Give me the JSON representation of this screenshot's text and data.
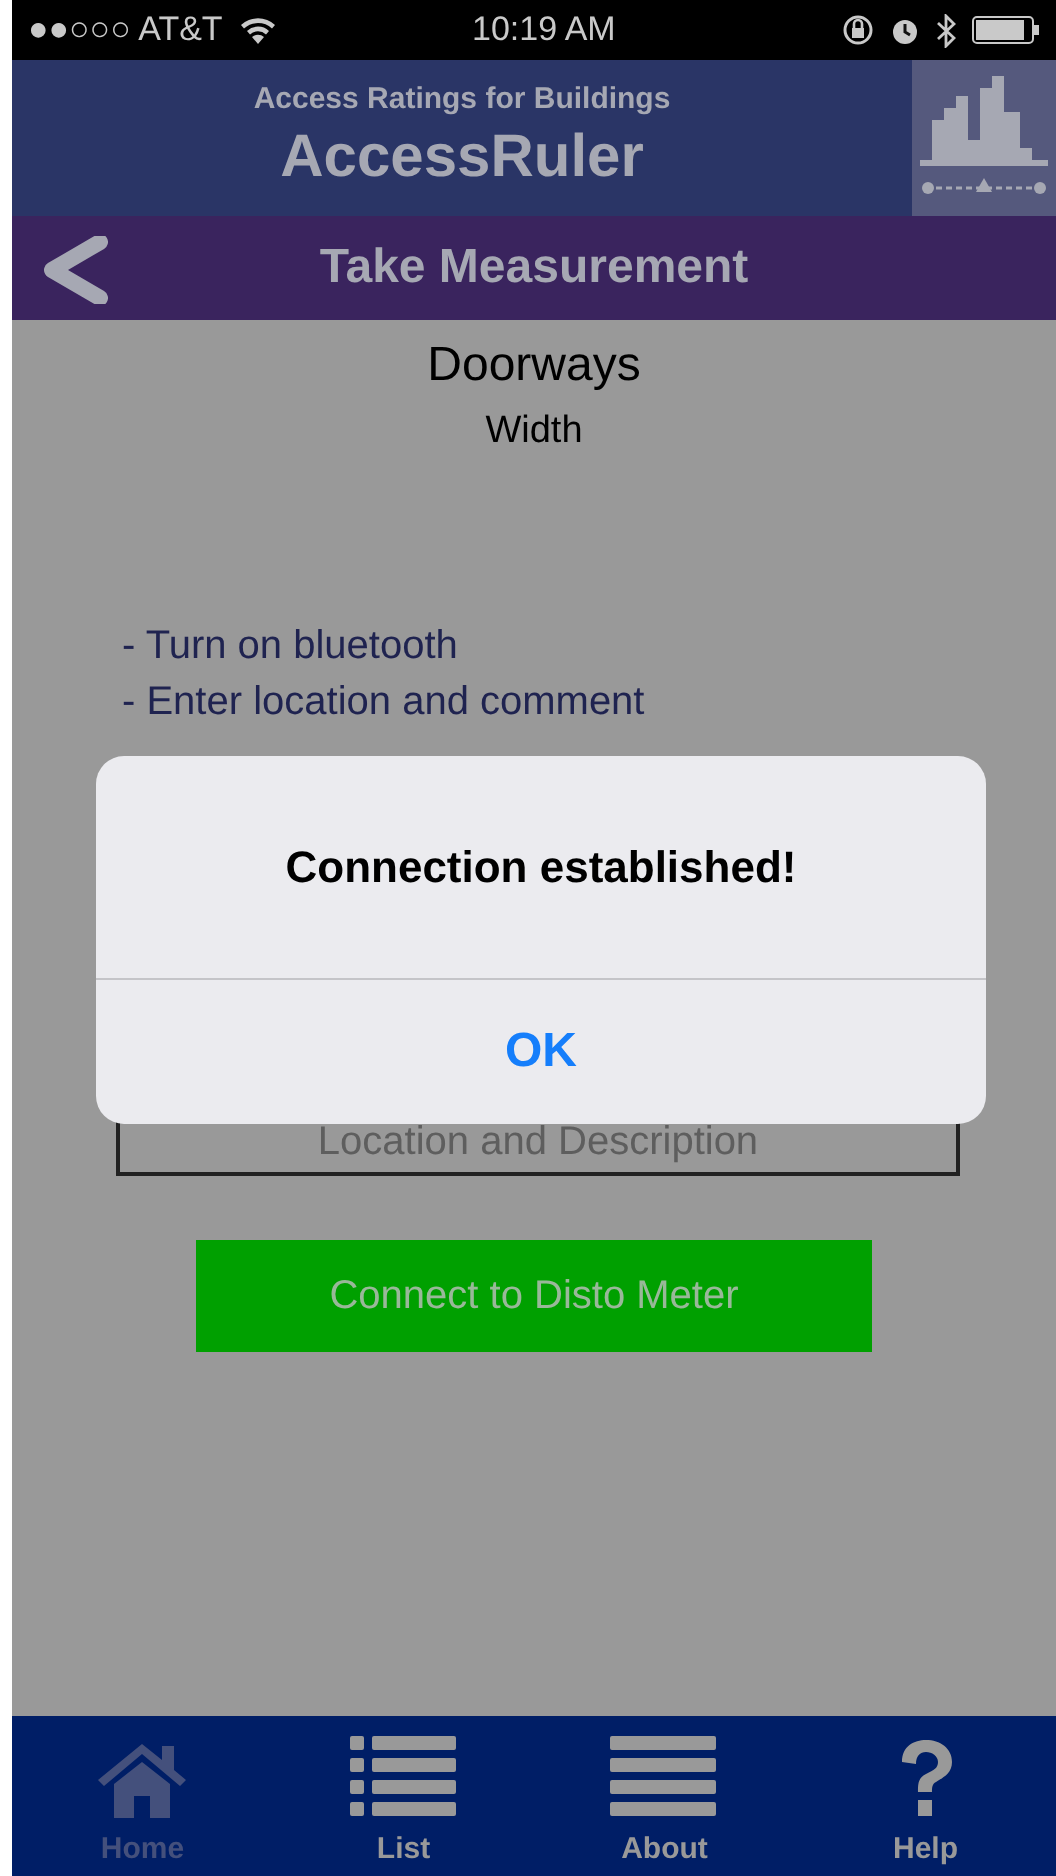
{
  "status_bar": {
    "carrier": "●●○○○ AT&T",
    "time": "10:19 AM"
  },
  "header": {
    "subtitle": "Access Ratings for Buildings",
    "title": "AccessRuler"
  },
  "nav_bar": {
    "title": "Take Measurement"
  },
  "content": {
    "heading": "Doorways",
    "subheading": "Width",
    "instructions": [
      "- Turn on bluetooth",
      "- Enter location and comment"
    ],
    "location_field": {
      "placeholder": "Location and Description"
    },
    "connect_button": "Connect to Disto Meter"
  },
  "tabs": [
    {
      "label": "Home",
      "kind": "home",
      "selected": true
    },
    {
      "label": "List",
      "kind": "list",
      "selected": false
    },
    {
      "label": "About",
      "kind": "menu",
      "selected": false
    },
    {
      "label": "Help",
      "kind": "help",
      "selected": false
    }
  ],
  "alert": {
    "message": "Connection established!",
    "button": "OK"
  }
}
